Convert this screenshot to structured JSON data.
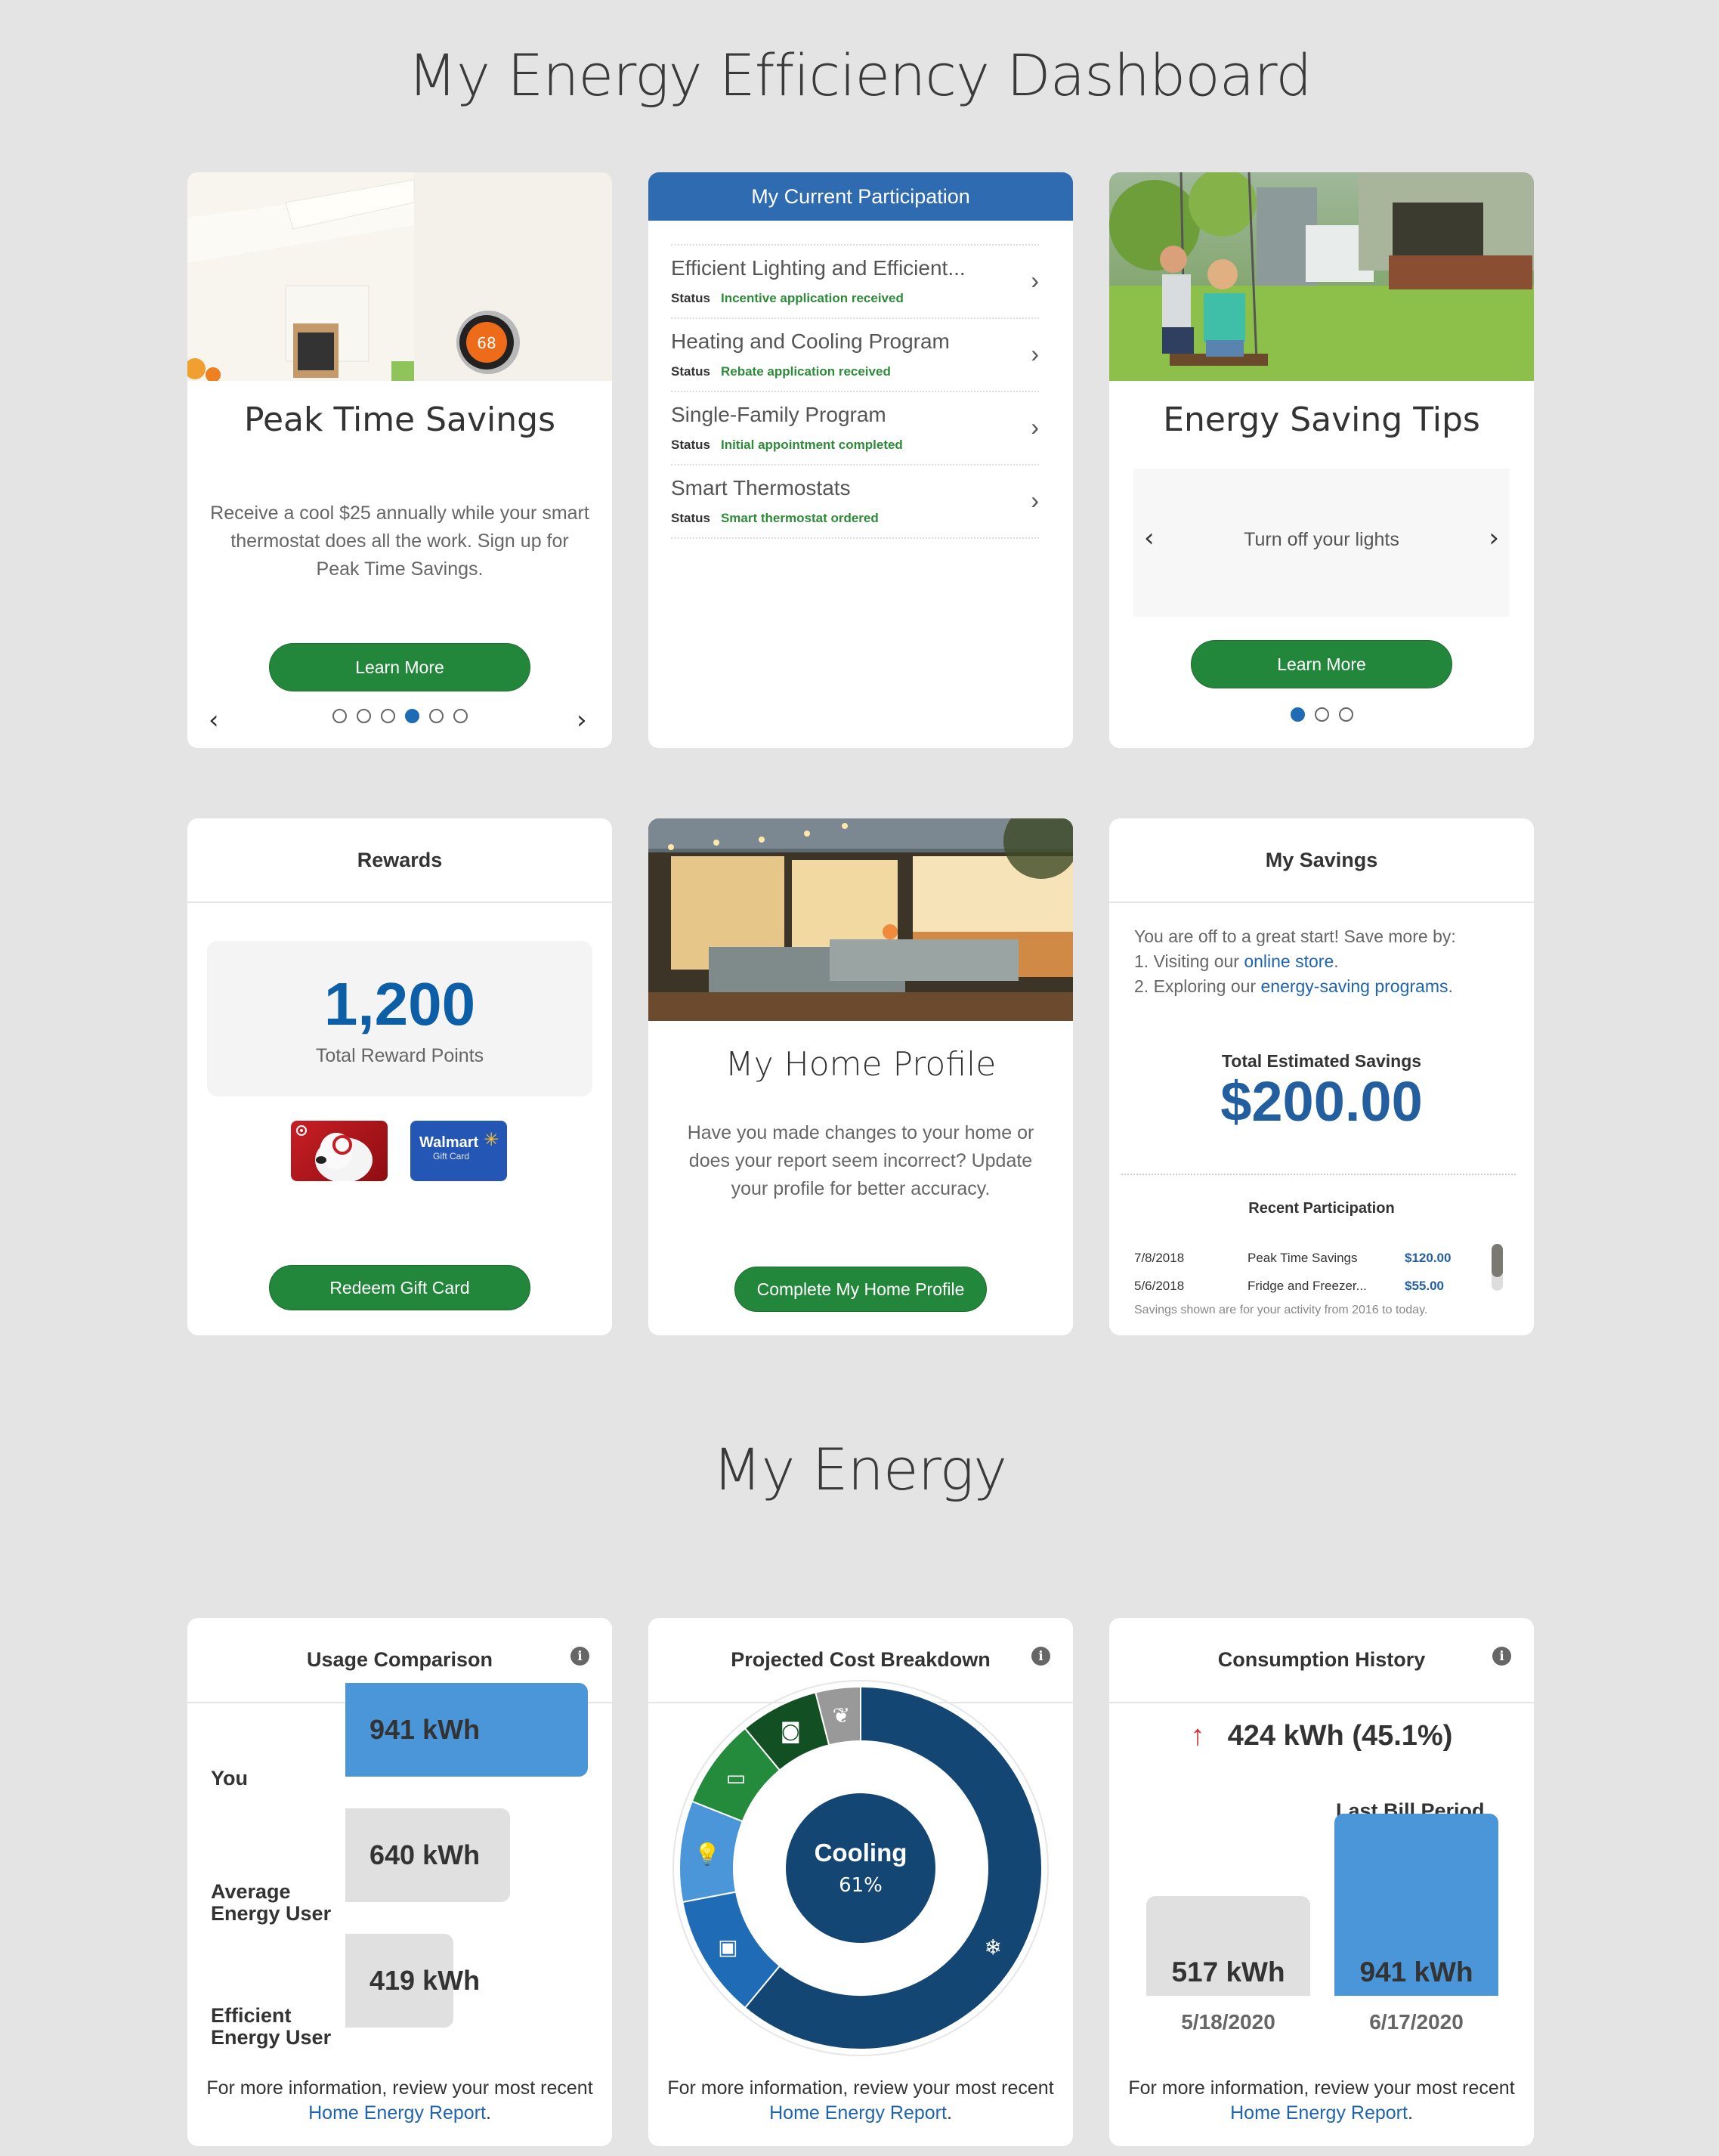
{
  "page": {
    "title": "My Energy Efficiency Dashboard",
    "section2_title": "My Energy"
  },
  "colors": {
    "background": "#e4e4e4",
    "primary_green": "#22873a",
    "primary_blue": "#2f6bb1",
    "link_blue": "#1f64ad",
    "status_green": "#2e8b3a",
    "bar_blue": "#4a96d9",
    "bar_gray": "#e0e0e0",
    "increase_red": "#d92b2b"
  },
  "peak_time": {
    "image": "kitchen-with-smart-thermostat",
    "thermostat_reading": "68",
    "title": "Peak Time Savings",
    "description": "Receive a cool $25 annually while your smart thermostat does all the work. Sign up for Peak Time Savings.",
    "button": "Learn More",
    "carousel_total": 6,
    "carousel_active": 4,
    "prev_icon": "chevron-left-icon",
    "next_icon": "chevron-right-icon"
  },
  "participation": {
    "title": "My Current Participation",
    "status_label": "Status",
    "items": [
      {
        "name": "Efficient Lighting and Efficient...",
        "status": "Incentive application received"
      },
      {
        "name": "Heating and Cooling Program",
        "status": "Rebate application received"
      },
      {
        "name": "Single-Family Program",
        "status": "Initial appointment completed"
      },
      {
        "name": "Smart Thermostats",
        "status": "Smart thermostat ordered"
      }
    ]
  },
  "tips": {
    "image": "kids-on-swing-in-backyard",
    "title": "Energy Saving Tips",
    "tip": "Turn off your lights",
    "button": "Learn More",
    "carousel_total": 3,
    "carousel_active": 1
  },
  "rewards": {
    "title": "Rewards",
    "points": "1,200",
    "points_label": "Total Reward Points",
    "gift_cards": [
      {
        "name": "Target",
        "icon": "target-gift-card"
      },
      {
        "name": "Walmart",
        "label": "Walmart",
        "sub": "Gift Card",
        "icon": "walmart-gift-card"
      }
    ],
    "button": "Redeem Gift Card"
  },
  "home_profile": {
    "image": "home-patio-evening",
    "title": "My Home Profile",
    "description": "Have you made changes to your home or does your report seem incorrect? Update your profile for better accuracy.",
    "button": "Complete My Home Profile"
  },
  "savings": {
    "title": "My Savings",
    "intro_line": "You are off to a great start! Save more by:",
    "item1_prefix": "1. Visiting our ",
    "item1_link": "online store",
    "item1_suffix": ".",
    "item2_prefix": "2. Exploring our ",
    "item2_link": "energy-saving programs",
    "item2_suffix": ".",
    "total_label": "Total Estimated Savings",
    "total_value": "$200.00",
    "recent_title": "Recent Participation",
    "recent": [
      {
        "date": "7/8/2018",
        "program": "Peak Time Savings",
        "amount": "$120.00"
      },
      {
        "date": "5/6/2018",
        "program": "Fridge and Freezer...",
        "amount": "$55.00"
      }
    ],
    "note": "Savings shown are for your activity from 2016 to today."
  },
  "footer_text": {
    "prefix": "For more information, review your most recent ",
    "link": "Home Energy Report",
    "suffix": "."
  },
  "usage": {
    "title": "Usage Comparison",
    "info_icon": "info-icon"
  },
  "breakdown": {
    "title": "Projected Cost Breakdown",
    "center_label": "Cooling",
    "center_value": "61%"
  },
  "consumption": {
    "title": "Consumption History",
    "change_text": "424 kWh (45.1%)",
    "direction": "up",
    "period_label": "Last Bill Period"
  },
  "chart_data": [
    {
      "type": "bar",
      "title": "Usage Comparison",
      "orientation": "horizontal",
      "categories": [
        "You",
        "Average Energy User",
        "Efficient Energy User"
      ],
      "values": [
        941,
        640,
        419
      ],
      "unit": "kWh",
      "labels": [
        "941 kWh",
        "640 kWh",
        "419 kWh"
      ],
      "highlight": "You",
      "xlim": [
        0,
        941
      ]
    },
    {
      "type": "pie",
      "title": "Projected Cost Breakdown",
      "donut": true,
      "categories": [
        "Cooling",
        "Appliances",
        "Lighting",
        "Electronics",
        "Laundry",
        "Other"
      ],
      "values": [
        61,
        11,
        9,
        8,
        7,
        4
      ],
      "unit": "%",
      "icons": [
        "snowflake-icon",
        "appliances-icon",
        "lightbulb-icon",
        "tv-icon",
        "washer-icon",
        "leaf-icon"
      ],
      "colors": [
        "#144674",
        "#1f6bb5",
        "#4a96d9",
        "#248a3c",
        "#124f22",
        "#999999"
      ],
      "selected": "Cooling"
    },
    {
      "type": "bar",
      "title": "Consumption History",
      "categories": [
        "5/18/2020",
        "6/17/2020"
      ],
      "values": [
        517,
        941
      ],
      "unit": "kWh",
      "labels": [
        "517 kWh",
        "941 kWh"
      ],
      "highlight": "6/17/2020",
      "annotation": "Last Bill Period",
      "ylim": [
        0,
        941
      ]
    }
  ]
}
